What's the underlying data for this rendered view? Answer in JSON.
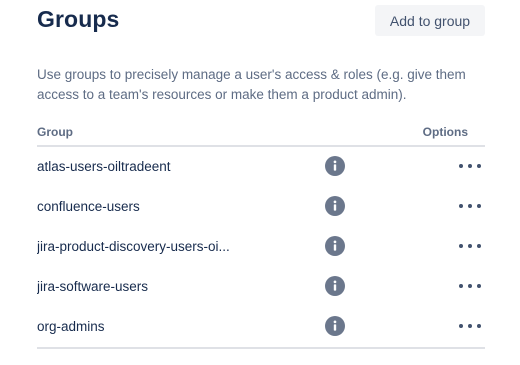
{
  "header": {
    "title": "Groups",
    "add_button_label": "Add to group"
  },
  "description": "Use groups to precisely manage a user's access & roles (e.g. give them access to a team's resources or make them a product admin).",
  "table": {
    "columns": {
      "group": "Group",
      "options": "Options"
    },
    "rows": [
      {
        "name": "atlas-users-oiltradeent",
        "info_icon": "info-icon",
        "options_icon": "more-horizontal-icon"
      },
      {
        "name": "confluence-users",
        "info_icon": "info-icon",
        "options_icon": "more-horizontal-icon"
      },
      {
        "name": "jira-product-discovery-users-oi...",
        "info_icon": "info-icon",
        "options_icon": "more-horizontal-icon"
      },
      {
        "name": "jira-software-users",
        "info_icon": "info-icon",
        "options_icon": "more-horizontal-icon"
      },
      {
        "name": "org-admins",
        "info_icon": "info-icon",
        "options_icon": "more-horizontal-icon"
      }
    ]
  },
  "colors": {
    "title": "#172b4d",
    "secondary_text": "#5e6c84",
    "button_bg": "#f4f5f7",
    "icon": "#6b778c",
    "divider": "#dfe1e6"
  }
}
